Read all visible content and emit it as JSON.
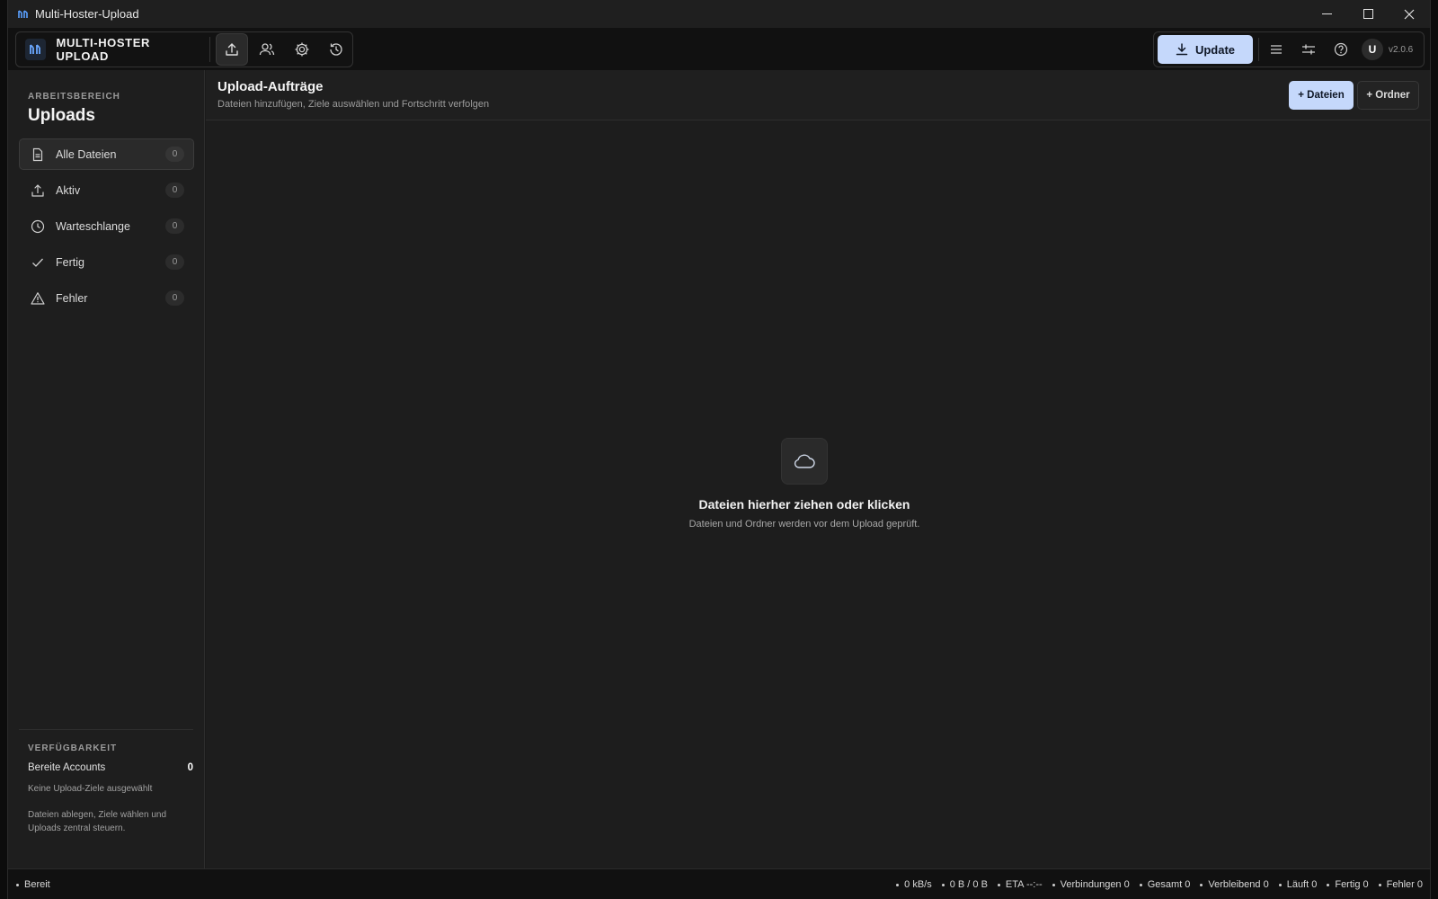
{
  "window": {
    "title": "Multi-Hoster-Upload"
  },
  "header": {
    "brand": "MULTI-HOSTER UPLOAD",
    "update_label": "Update",
    "avatar_initial": "U",
    "version": "v2.0.6"
  },
  "sidebar": {
    "section_label": "ARBEITSBEREICH",
    "title": "Uploads",
    "items": [
      {
        "label": "Alle Dateien",
        "count": "0",
        "icon": "file-icon"
      },
      {
        "label": "Aktiv",
        "count": "0",
        "icon": "upload-icon"
      },
      {
        "label": "Warteschlange",
        "count": "0",
        "icon": "clock-icon"
      },
      {
        "label": "Fertig",
        "count": "0",
        "icon": "check-icon"
      },
      {
        "label": "Fehler",
        "count": "0",
        "icon": "warning-icon"
      }
    ],
    "footer": {
      "label": "VERFÜGBARKEIT",
      "accounts_label": "Bereite Accounts",
      "accounts_count": "0",
      "note": "Keine Upload-Ziele ausgewählt",
      "description": "Dateien ablegen, Ziele wählen und Uploads zentral steuern."
    }
  },
  "main": {
    "title": "Upload-Aufträge",
    "subtitle": "Dateien hinzufügen, Ziele auswählen und Fortschritt verfolgen",
    "add_files_label": "+ Dateien",
    "add_folder_label": "+ Ordner",
    "dropzone": {
      "icon": "cloud-icon",
      "title": "Dateien hierher ziehen oder klicken",
      "subtitle": "Dateien und Ordner werden vor dem Upload geprüft."
    }
  },
  "statusbar": {
    "status": "Bereit",
    "speed": "0 kB/s",
    "transferred": "0 B / 0 B",
    "eta": "ETA --:--",
    "connections": "Verbindungen 0",
    "total": "Gesamt 0",
    "remaining": "Verbleibend 0",
    "running": "Läuft 0",
    "done": "Fertig 0",
    "errors": "Fehler 0"
  },
  "colors": {
    "accent": "#c5d8fb",
    "background": "#1d1d1d",
    "sidebar": "#1e1e1e"
  }
}
